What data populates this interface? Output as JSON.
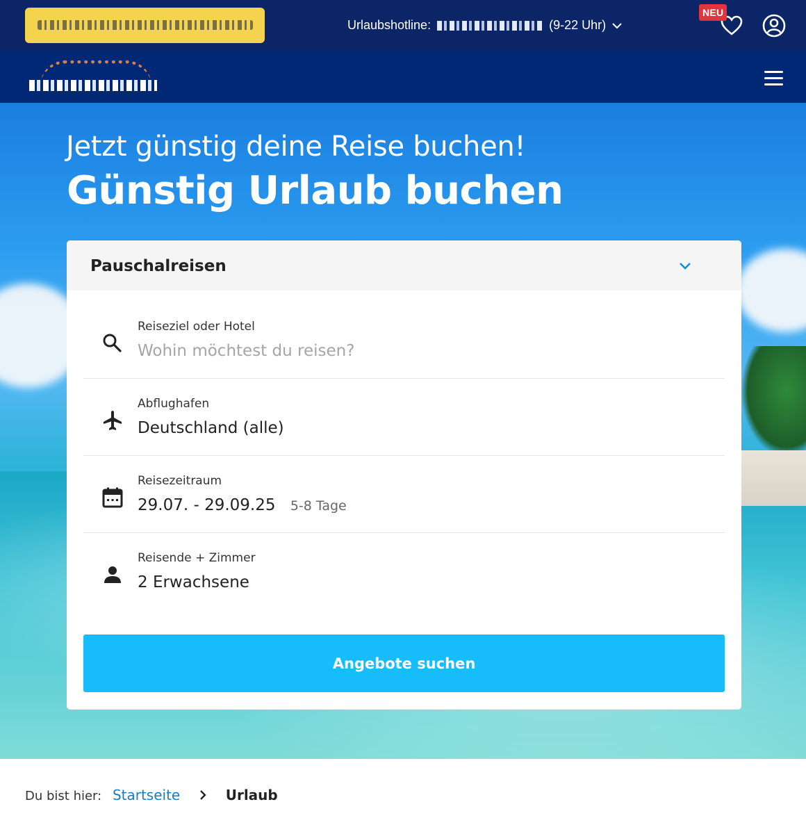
{
  "topbar": {
    "promo_text": "",
    "hotline_label": "Urlaubshotline:",
    "hotline_hours": "(9-22 Uhr)",
    "badge_new": "NEU",
    "icons": {
      "wishlist": "heart-icon",
      "account": "user-circle-icon",
      "hotline_toggle": "chevron-down-icon"
    }
  },
  "navbar": {
    "logo": "brand-logo",
    "menu_icon": "hamburger-menu-icon"
  },
  "hero": {
    "kicker": "Jetzt günstig deine Reise buchen!",
    "headline": "Günstig Urlaub buchen"
  },
  "search": {
    "product_type": "Pauschalreisen",
    "fields": [
      {
        "label": "Reiseziel oder Hotel",
        "placeholder": "Wohin möchtest du reisen?",
        "icon": "search-icon"
      },
      {
        "label": "Abflughafen",
        "value": "Deutschland (alle)",
        "icon": "airplane-icon"
      },
      {
        "label": "Reisezeitraum",
        "value": "29.07. - 29.09.25",
        "duration": "5-8 Tage",
        "icon": "calendar-icon"
      },
      {
        "label": "Reisende + Zimmer",
        "value": "2 Erwachsene",
        "icon": "person-icon"
      }
    ],
    "submit_label": "Angebote suchen"
  },
  "breadcrumb": {
    "prefix": "Du bist hier:",
    "items": [
      "Startseite",
      "Urlaub"
    ]
  },
  "colors": {
    "topbar": "#0b2566",
    "navbar": "#002875",
    "cta": "#16bdfa",
    "badge": "#e2343c",
    "link": "#1b7bbf"
  }
}
